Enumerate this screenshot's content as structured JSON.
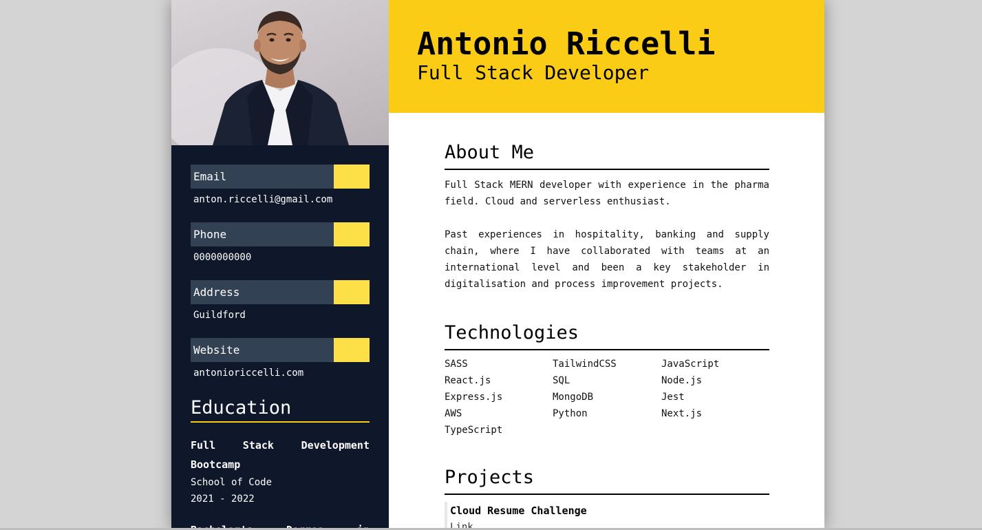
{
  "profile": {
    "name": "Antonio Riccelli",
    "role": "Full Stack Developer"
  },
  "contacts": [
    {
      "label": "Email",
      "value": "anton.riccelli@gmail.com"
    },
    {
      "label": "Phone",
      "value": "0000000000"
    },
    {
      "label": "Address",
      "value": "Guildford"
    },
    {
      "label": "Website",
      "value": "antonioriccelli.com"
    }
  ],
  "education": {
    "title": "Education",
    "items": [
      {
        "degree": "Full Stack Development Bootcamp",
        "school": "School of Code",
        "years": "2021 - 2022"
      },
      {
        "degree": "Bachelor's Degree in",
        "school": "",
        "years": ""
      }
    ]
  },
  "about": {
    "title": "About Me",
    "paragraphs": [
      "Full Stack MERN developer with experience in the pharma field. Cloud and serverless enthusiast.",
      "Past experiences in hospitality, banking and supply chain, where I have collaborated with teams at an international level and been a key stakeholder in digitalisation and process improvement projects."
    ]
  },
  "technologies": {
    "title": "Technologies",
    "items": [
      "SASS",
      "TailwindCSS",
      "JavaScript",
      "React.js",
      "SQL",
      "Node.js",
      "Express.js",
      "MongoDB",
      "Jest",
      "AWS",
      "Python",
      "Next.js",
      "TypeScript"
    ]
  },
  "projects": {
    "title": "Projects",
    "items": [
      {
        "name": "Cloud Resume Challenge",
        "sub": "Link"
      }
    ]
  },
  "colors": {
    "accent": "#facc15",
    "swatch": "#fde047",
    "sidebar": "#0f172a",
    "label_bg": "#334155"
  }
}
